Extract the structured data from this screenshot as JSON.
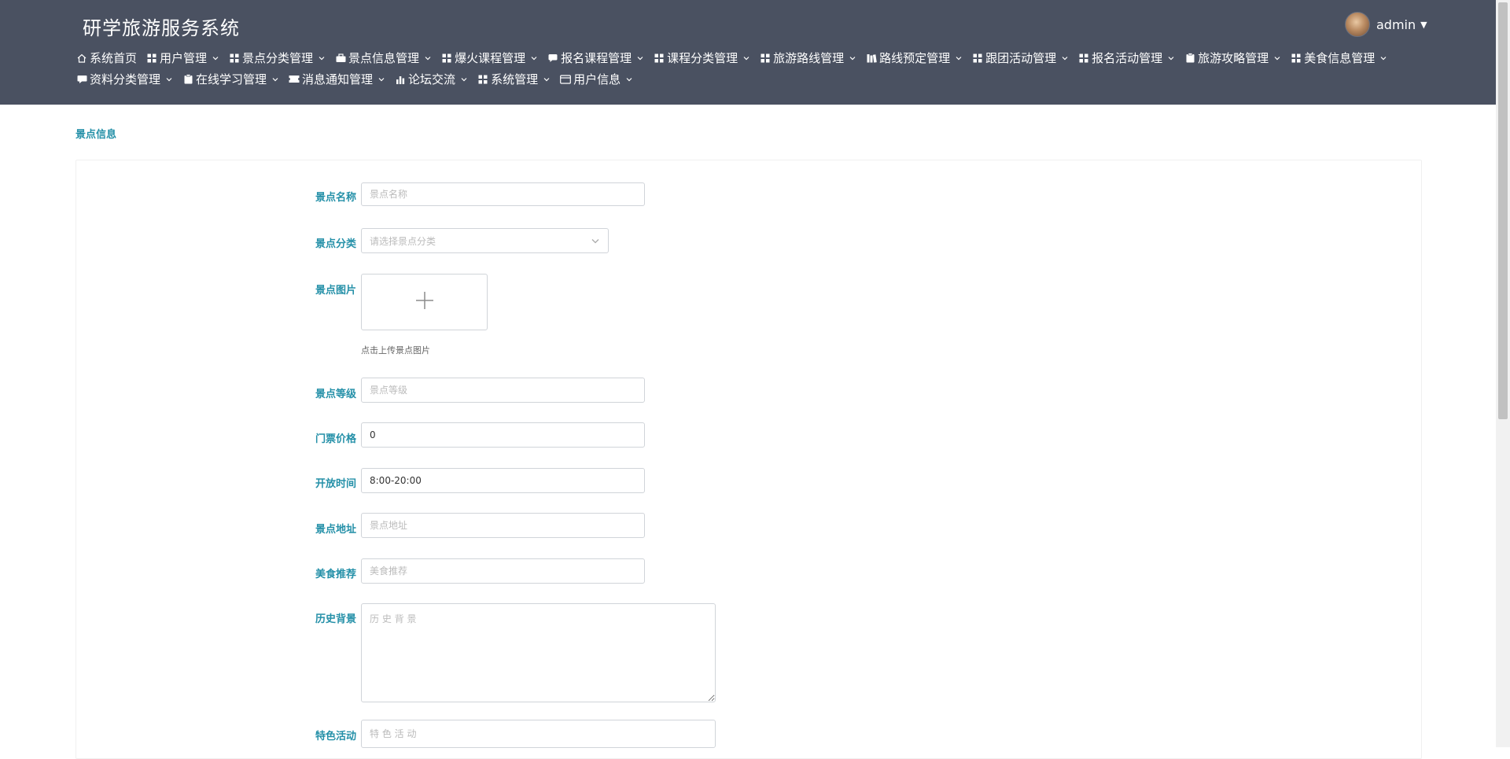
{
  "app": {
    "title": "研学旅游服务系统"
  },
  "user": {
    "name": "admin"
  },
  "nav": [
    {
      "label": "系统首页",
      "icon": "home-icon",
      "dropdown": false
    },
    {
      "label": "用户管理",
      "icon": "grid-icon",
      "dropdown": true
    },
    {
      "label": "景点分类管理",
      "icon": "grid-icon",
      "dropdown": true
    },
    {
      "label": "景点信息管理",
      "icon": "briefcase-icon",
      "dropdown": true
    },
    {
      "label": "爆火课程管理",
      "icon": "grid-icon",
      "dropdown": true
    },
    {
      "label": "报名课程管理",
      "icon": "chat-icon",
      "dropdown": true
    },
    {
      "label": "课程分类管理",
      "icon": "grid-icon",
      "dropdown": true
    },
    {
      "label": "旅游路线管理",
      "icon": "grid-icon",
      "dropdown": true
    },
    {
      "label": "路线预定管理",
      "icon": "books-icon",
      "dropdown": true
    },
    {
      "label": "跟团活动管理",
      "icon": "grid-icon",
      "dropdown": true
    },
    {
      "label": "报名活动管理",
      "icon": "grid-icon",
      "dropdown": true
    },
    {
      "label": "旅游攻略管理",
      "icon": "clipboard-icon",
      "dropdown": true
    },
    {
      "label": "美食信息管理",
      "icon": "grid-icon",
      "dropdown": true
    },
    {
      "label": "资料分类管理",
      "icon": "comment-icon",
      "dropdown": true
    },
    {
      "label": "在线学习管理",
      "icon": "clipboard-icon",
      "dropdown": true
    },
    {
      "label": "消息通知管理",
      "icon": "ticket-icon",
      "dropdown": true
    },
    {
      "label": "论坛交流",
      "icon": "bar-chart-icon",
      "dropdown": true
    },
    {
      "label": "系统管理",
      "icon": "grid-icon",
      "dropdown": true
    },
    {
      "label": "用户信息",
      "icon": "card-icon",
      "dropdown": true
    }
  ],
  "breadcrumb": "景点信息",
  "form": {
    "name": {
      "label": "景点名称",
      "placeholder": "景点名称",
      "value": ""
    },
    "category": {
      "label": "景点分类",
      "placeholder": "请选择景点分类"
    },
    "image": {
      "label": "景点图片",
      "hint": "点击上传景点图片"
    },
    "level": {
      "label": "景点等级",
      "placeholder": "景点等级",
      "value": ""
    },
    "price": {
      "label": "门票价格",
      "placeholder": "门票价格",
      "value": "0"
    },
    "hours": {
      "label": "开放时间",
      "placeholder": "开放时间",
      "value": "8:00-20:00"
    },
    "address": {
      "label": "景点地址",
      "placeholder": "景点地址",
      "value": ""
    },
    "food": {
      "label": "美食推荐",
      "placeholder": "美食推荐",
      "value": ""
    },
    "history": {
      "label": "历史背景",
      "placeholder": "历 史 背 景"
    },
    "activity": {
      "label": "特色活动",
      "placeholder": "特 色 活 动"
    }
  },
  "colors": {
    "header_bg": "#4a5161",
    "accent": "#2490a8"
  }
}
